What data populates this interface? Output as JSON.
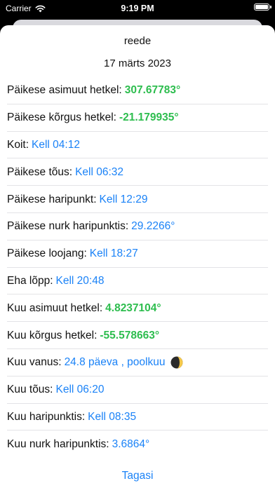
{
  "status": {
    "carrier": "Carrier",
    "time": "9:19 PM",
    "battery_level": 1.0
  },
  "header": {
    "day": "reede",
    "date": "17 märts 2023"
  },
  "rows": [
    {
      "label": "Päikese asimuut hetkel:",
      "value": "307.67783°",
      "color": "green"
    },
    {
      "label": "Päikese kõrgus hetkel:",
      "value": "-21.179935°",
      "color": "green"
    },
    {
      "label": "Koit:",
      "value": "Kell 04:12",
      "color": "blue"
    },
    {
      "label": "Päikese tõus:",
      "value": "Kell 06:32",
      "color": "blue"
    },
    {
      "label": "Päikese haripunkt:",
      "value": "Kell 12:29",
      "color": "blue"
    },
    {
      "label": "Päikese nurk haripunktis:",
      "value": "29.2266°",
      "color": "blue"
    },
    {
      "label": "Päikese loojang:",
      "value": "Kell 18:27",
      "color": "blue"
    },
    {
      "label": "Eha lõpp:",
      "value": "Kell 20:48",
      "color": "blue"
    },
    {
      "label": "Kuu asimuut hetkel:",
      "value": "4.8237104°",
      "color": "green"
    },
    {
      "label": "Kuu kõrgus hetkel:",
      "value": "-55.578663°",
      "color": "green"
    },
    {
      "label": "Kuu vanus:",
      "value": "24.8 päeva , poolkuu",
      "color": "blue",
      "icon": "moon-phase-icon"
    },
    {
      "label": "Kuu tõus:",
      "value": "Kell 06:20",
      "color": "blue"
    },
    {
      "label": "Kuu haripunktis:",
      "value": "Kell 08:35",
      "color": "blue"
    },
    {
      "label": "Kuu nurk haripunktis:",
      "value": "3.6864°",
      "color": "blue"
    }
  ],
  "footer": {
    "back_label": "Tagasi"
  },
  "colors": {
    "blue": "#1a82f7",
    "green": "#2dbd4e"
  }
}
